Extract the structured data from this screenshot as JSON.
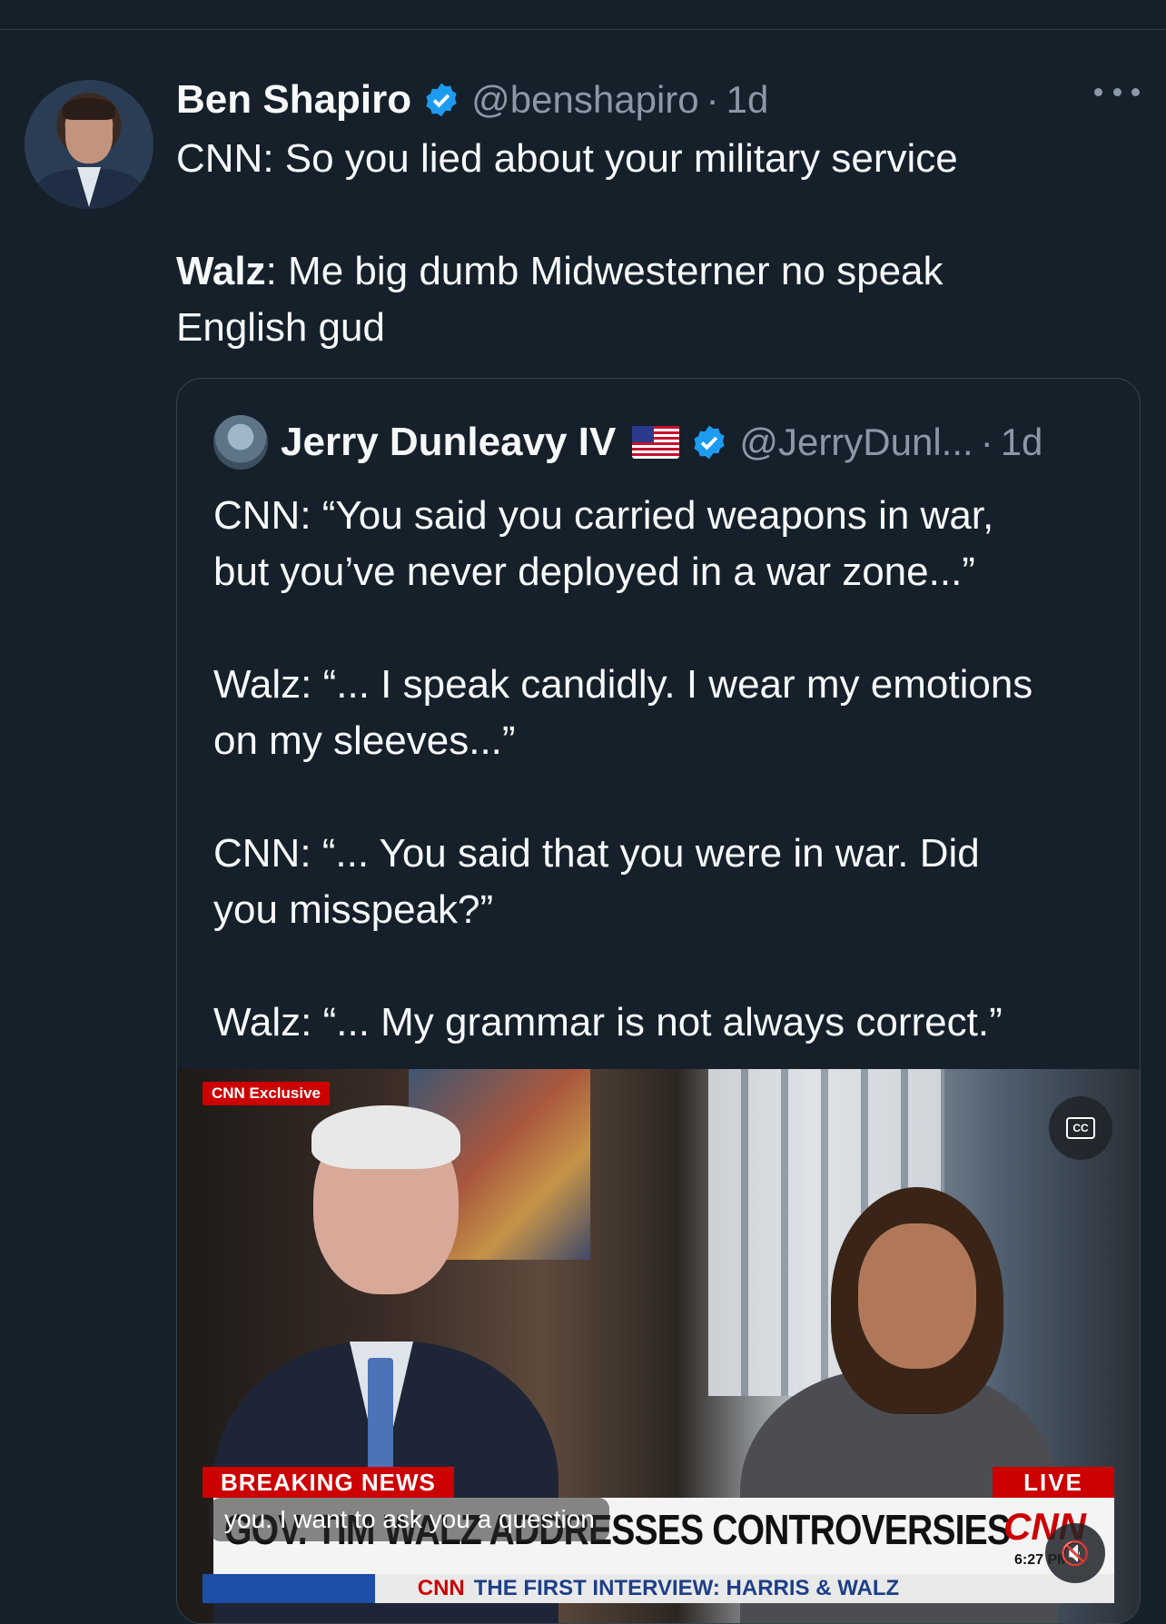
{
  "post": {
    "author_name": "Ben Shapiro",
    "handle": "@benshapiro",
    "separator": "·",
    "time": "1d",
    "text_line1": "CNN: So you lied about your military service",
    "text_speaker": "Walz",
    "text_line2": ": Me big dumb Midwesterner no speak",
    "text_line3": "English gud"
  },
  "quoted": {
    "author_name": "Jerry Dunleavy IV",
    "handle": "@JerryDunl...",
    "separator": "·",
    "time": "1d",
    "paragraphs": [
      [
        "CNN: “You said you carried weapons in war,",
        "but you’ve never deployed in a war zone...”"
      ],
      [
        "Walz: “... I speak candidly. I wear my emotions",
        "on my sleeves...”"
      ],
      [
        "CNN: “... You said that you were in war. Did",
        "you misspeak?”"
      ],
      [
        "Walz: “... My grammar is not always correct.”"
      ]
    ]
  },
  "video": {
    "tag": "CNN Exclusive",
    "cc_label": "CC",
    "breaking_label": "BREAKING NEWS",
    "live_label": "LIVE",
    "headline": "GOV. TIM WALZ ADDRESSES CONTROVERSIES",
    "network": "CNN",
    "clock": "6:27 PM",
    "ticker_brand": "CNN",
    "ticker_text": "THE FIRST INTERVIEW: HARRIS & WALZ",
    "caption": "you. I want to ask you a question"
  },
  "colors": {
    "background": "#15202b",
    "verified": "#1d9bf0",
    "muted": "#8b98a5",
    "cnn_red": "#cc0000"
  }
}
